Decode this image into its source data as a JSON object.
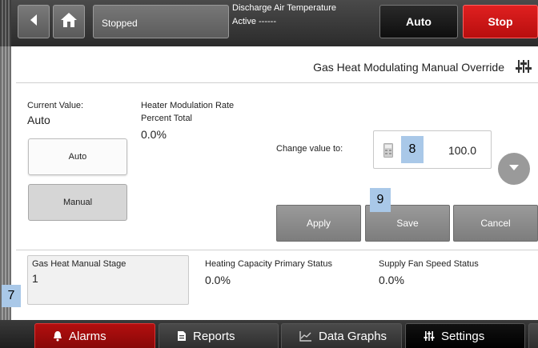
{
  "header": {
    "status": "Stopped",
    "info_line1": "Discharge Air Temperature",
    "info_line2": "Active ------",
    "auto_label": "Auto",
    "stop_label": "Stop"
  },
  "page": {
    "title": "Gas Heat Modulating Manual Override"
  },
  "current": {
    "label": "Current Value:",
    "value": "Auto"
  },
  "rate": {
    "label_line1": "Heater Modulation Rate",
    "label_line2": "Percent Total",
    "value": "0.0%"
  },
  "mode_buttons": {
    "auto_label": "Auto",
    "manual_label": "Manual"
  },
  "change": {
    "label": "Change value to:",
    "value": "100.0"
  },
  "actions": {
    "apply_label": "Apply",
    "save_label": "Save",
    "cancel_label": "Cancel"
  },
  "markers": {
    "m7": "7",
    "m8": "8",
    "m9": "9"
  },
  "status_panel": {
    "stage_label": "Gas Heat Manual Stage",
    "stage_value": "1",
    "capacity_label": "Heating Capacity Primary Status",
    "capacity_value": "0.0%",
    "fan_label": "Supply Fan Speed Status",
    "fan_value": "0.0%"
  },
  "tabs": [
    {
      "label": "Alarms",
      "icon": "bell-icon"
    },
    {
      "label": "Reports",
      "icon": "document-icon"
    },
    {
      "label": "Data Graphs",
      "icon": "chart-icon"
    },
    {
      "label": "Settings",
      "icon": "sliders-icon"
    }
  ],
  "colors": {
    "stop_red": "#cc1515",
    "alarm_red": "#a50d0d",
    "marker_blue": "#a9c8e8"
  }
}
